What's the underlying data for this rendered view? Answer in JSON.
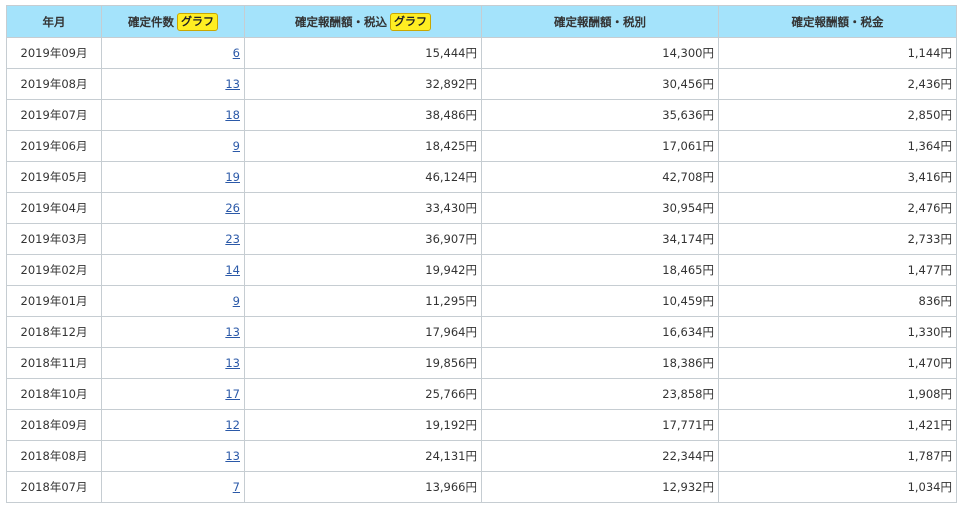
{
  "table": {
    "headers": {
      "month": "年月",
      "count": "確定件数",
      "gross": "確定報酬額・税込",
      "net": "確定報酬額・税別",
      "tax": "確定報酬額・税金",
      "graph_label": "グラフ"
    },
    "rows": [
      {
        "month": "2019年09月",
        "count": "6",
        "gross": "15,444円",
        "net": "14,300円",
        "tax": "1,144円"
      },
      {
        "month": "2019年08月",
        "count": "13",
        "gross": "32,892円",
        "net": "30,456円",
        "tax": "2,436円"
      },
      {
        "month": "2019年07月",
        "count": "18",
        "gross": "38,486円",
        "net": "35,636円",
        "tax": "2,850円"
      },
      {
        "month": "2019年06月",
        "count": "9",
        "gross": "18,425円",
        "net": "17,061円",
        "tax": "1,364円"
      },
      {
        "month": "2019年05月",
        "count": "19",
        "gross": "46,124円",
        "net": "42,708円",
        "tax": "3,416円"
      },
      {
        "month": "2019年04月",
        "count": "26",
        "gross": "33,430円",
        "net": "30,954円",
        "tax": "2,476円"
      },
      {
        "month": "2019年03月",
        "count": "23",
        "gross": "36,907円",
        "net": "34,174円",
        "tax": "2,733円"
      },
      {
        "month": "2019年02月",
        "count": "14",
        "gross": "19,942円",
        "net": "18,465円",
        "tax": "1,477円"
      },
      {
        "month": "2019年01月",
        "count": "9",
        "gross": "11,295円",
        "net": "10,459円",
        "tax": "836円"
      },
      {
        "month": "2018年12月",
        "count": "13",
        "gross": "17,964円",
        "net": "16,634円",
        "tax": "1,330円"
      },
      {
        "month": "2018年11月",
        "count": "13",
        "gross": "19,856円",
        "net": "18,386円",
        "tax": "1,470円"
      },
      {
        "month": "2018年10月",
        "count": "17",
        "gross": "25,766円",
        "net": "23,858円",
        "tax": "1,908円"
      },
      {
        "month": "2018年09月",
        "count": "12",
        "gross": "19,192円",
        "net": "17,771円",
        "tax": "1,421円"
      },
      {
        "month": "2018年08月",
        "count": "13",
        "gross": "24,131円",
        "net": "22,344円",
        "tax": "1,787円"
      },
      {
        "month": "2018年07月",
        "count": "7",
        "gross": "13,966円",
        "net": "12,932円",
        "tax": "1,034円"
      }
    ]
  },
  "colors": {
    "header_bg": "#a4e3fb",
    "graph_badge_bg": "#ffee22",
    "link": "#2b59a8",
    "border": "#c6cdd2"
  }
}
